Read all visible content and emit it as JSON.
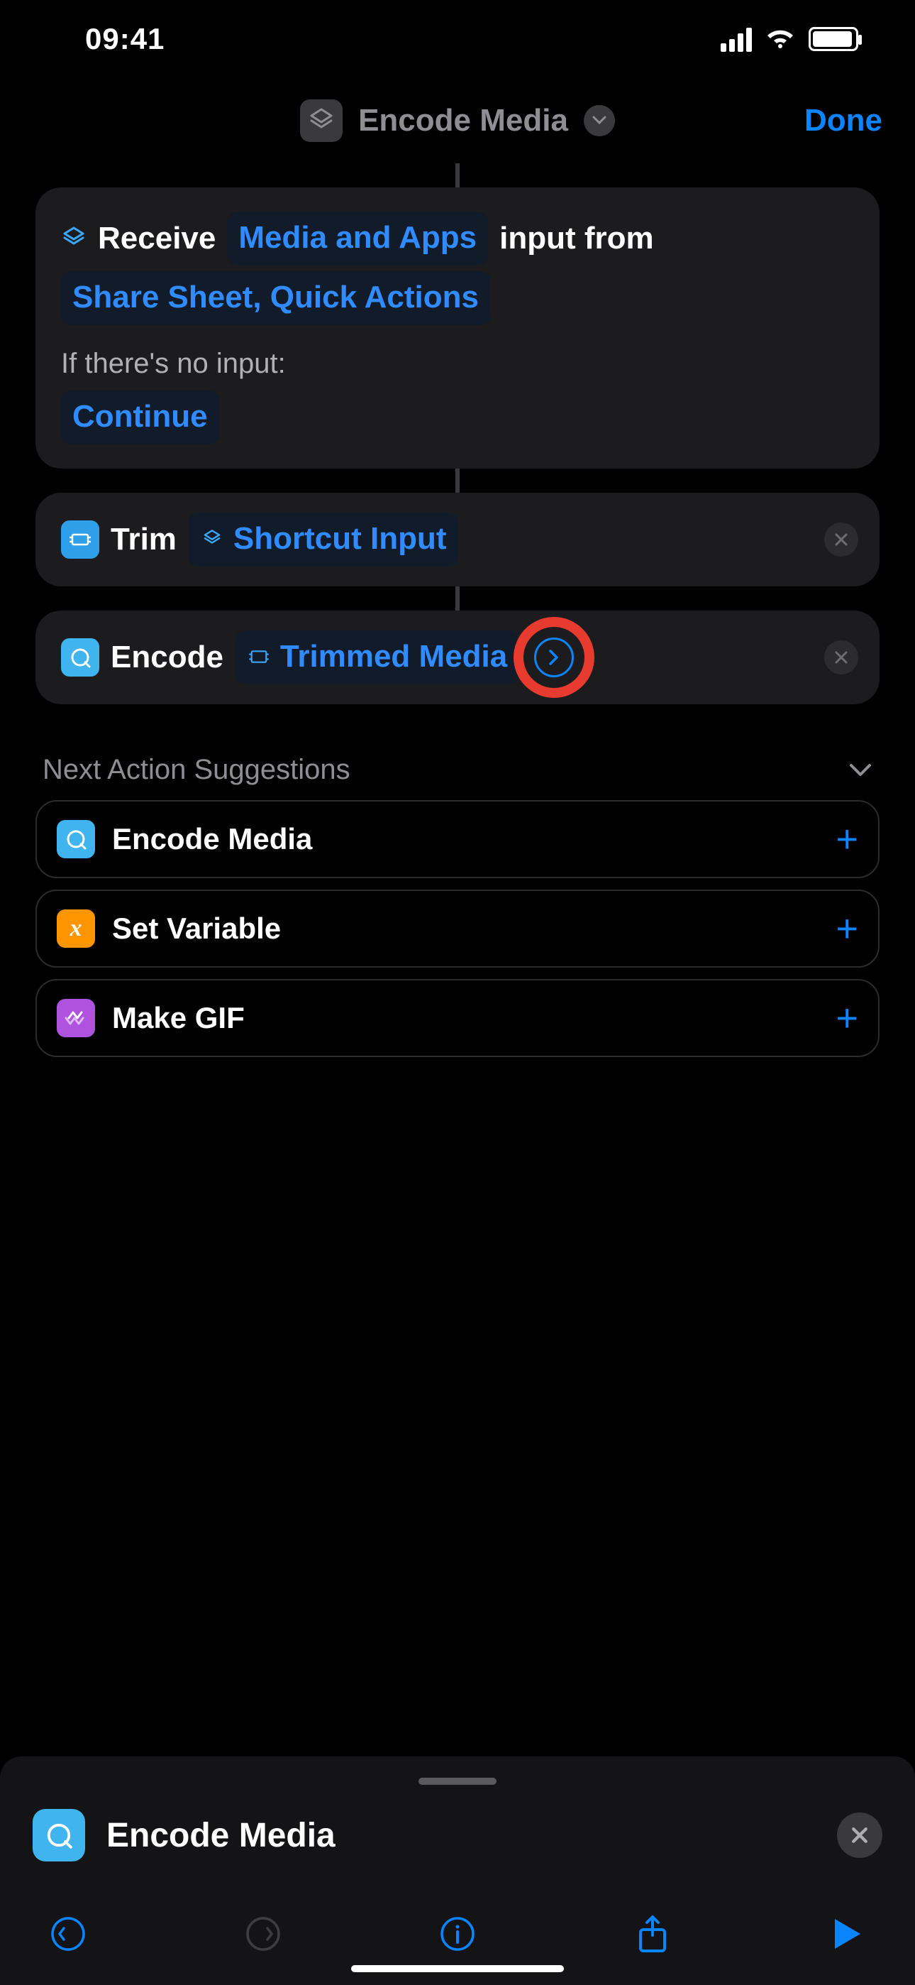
{
  "statusbar": {
    "time": "09:41"
  },
  "navbar": {
    "title": "Encode Media",
    "done": "Done"
  },
  "input_card": {
    "receive": "Receive",
    "types": "Media and Apps",
    "input_from": "input from",
    "sources": "Share Sheet, Quick Actions",
    "no_input_label": "If there's no input:",
    "no_input_action": "Continue"
  },
  "actions": {
    "trim": {
      "title": "Trim",
      "var": "Shortcut Input"
    },
    "encode": {
      "title": "Encode",
      "var": "Trimmed Media"
    }
  },
  "suggestions": {
    "header": "Next Action Suggestions",
    "items": [
      {
        "label": "Encode Media",
        "icon": "quicktime",
        "color": "lightblue"
      },
      {
        "label": "Set Variable",
        "icon": "x",
        "color": "orange"
      },
      {
        "label": "Make GIF",
        "icon": "gif",
        "color": "purple"
      }
    ]
  },
  "sheet": {
    "search": "Encode Media"
  }
}
